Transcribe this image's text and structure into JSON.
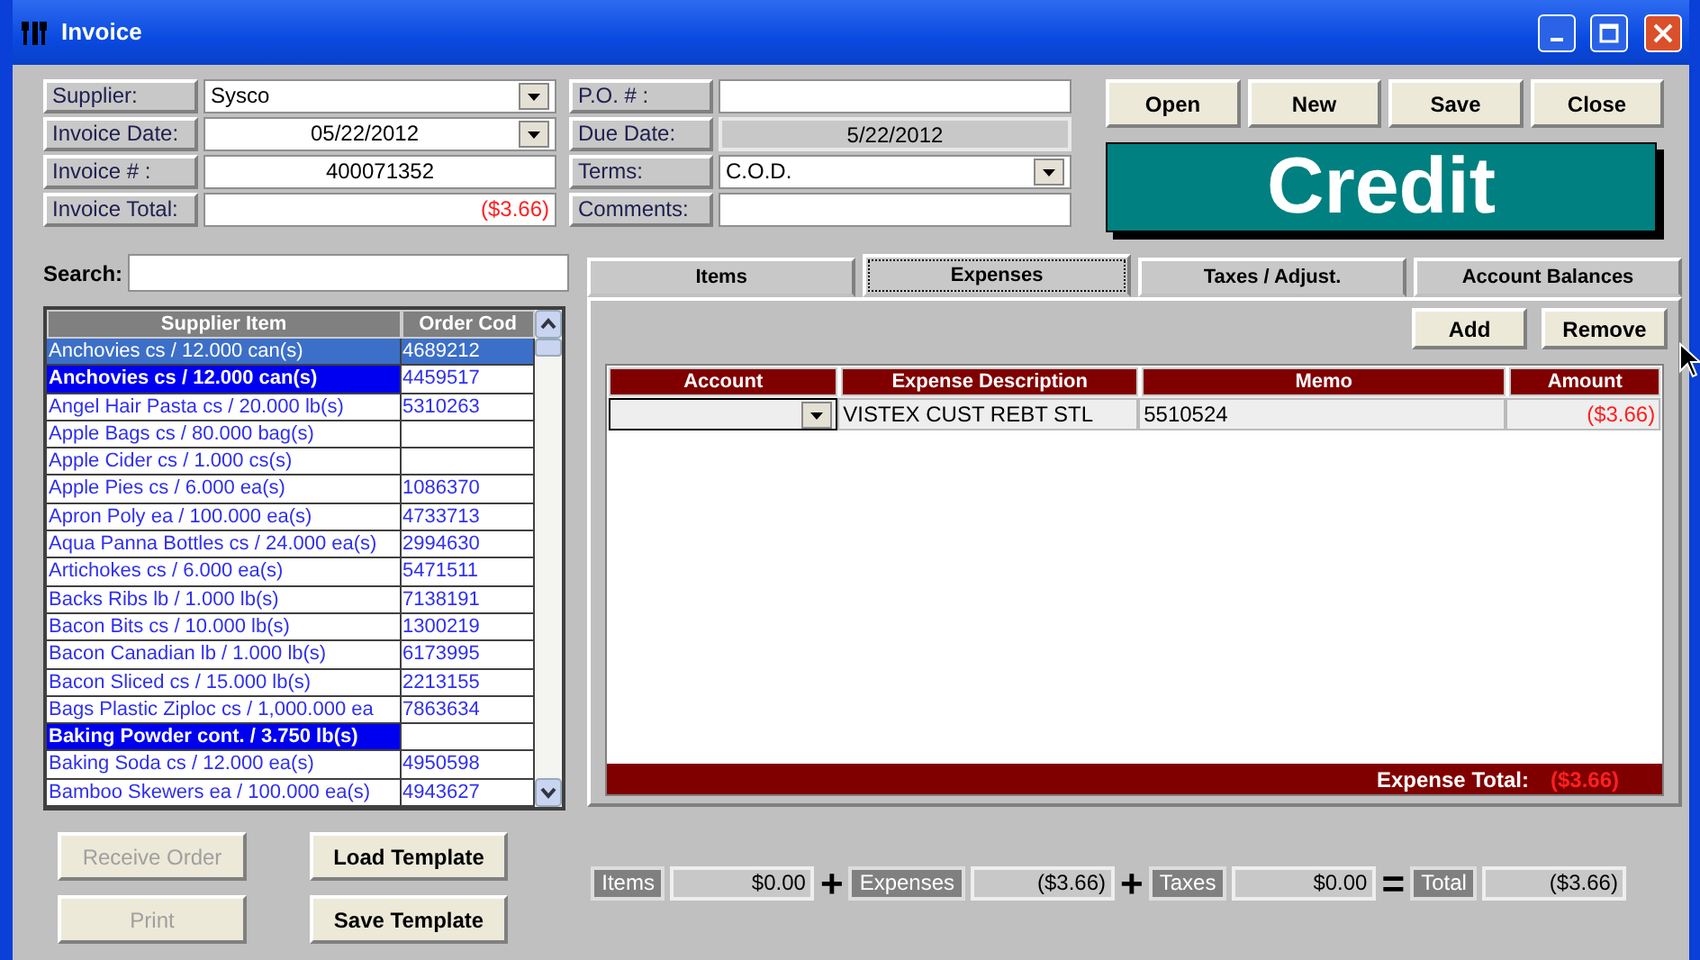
{
  "window": {
    "title": "Invoice"
  },
  "header_left": [
    {
      "label": "Supplier:",
      "value": "Sysco",
      "kind": "dropdown"
    },
    {
      "label": "Invoice Date:",
      "value": "05/22/2012",
      "kind": "date"
    },
    {
      "label": "Invoice # :",
      "value": "400071352",
      "kind": "centered"
    },
    {
      "label": "Invoice Total:",
      "value": "($3.66)",
      "kind": "amount"
    }
  ],
  "header_middle": [
    {
      "label": "P.O. # :",
      "kind": "text"
    },
    {
      "label": "Due Date:",
      "value": "5/22/2012",
      "kind": "readonly"
    },
    {
      "label": "Terms:",
      "value": "C.O.D.",
      "kind": "dropdown"
    },
    {
      "label": "Comments:",
      "kind": "text"
    }
  ],
  "action_buttons": [
    "Open",
    "New",
    "Save",
    "Close"
  ],
  "banner": "Credit",
  "search": {
    "label": "Search:"
  },
  "supplier_items": {
    "columns": [
      "Supplier Item",
      "Order Cod"
    ],
    "rows": [
      {
        "item": "Anchovies cs / 12.000 can(s)",
        "code": "4689212",
        "selected": true,
        "current": true
      },
      {
        "item": "Anchovies cs / 12.000 can(s)",
        "code": "4459517",
        "selected": true,
        "current": false
      },
      {
        "item": "Angel Hair Pasta cs / 20.000 lb(s)",
        "code": "5310263",
        "selected": false,
        "current": false
      },
      {
        "item": "Apple Bags cs / 80.000 bag(s)",
        "selected": false,
        "current": false
      },
      {
        "item": "Apple Cider cs / 1.000 cs(s)",
        "selected": false,
        "current": false
      },
      {
        "item": "Apple Pies  cs / 6.000 ea(s)",
        "code": "1086370",
        "selected": false,
        "current": false
      },
      {
        "item": "Apron Poly ea / 100.000 ea(s)",
        "code": "4733713",
        "selected": false,
        "current": false
      },
      {
        "item": "Aqua Panna Bottles cs / 24.000 ea(s)",
        "code": "2994630",
        "selected": false,
        "current": false
      },
      {
        "item": "Artichokes cs / 6.000 ea(s)",
        "code": "5471511",
        "selected": false,
        "current": false
      },
      {
        "item": "Backs Ribs lb / 1.000 lb(s)",
        "code": "7138191",
        "selected": false,
        "current": false
      },
      {
        "item": "Bacon Bits cs / 10.000 lb(s)",
        "code": "1300219",
        "selected": false,
        "current": false
      },
      {
        "item": "Bacon Canadian  lb / 1.000 lb(s)",
        "code": "6173995",
        "selected": false,
        "current": false
      },
      {
        "item": "Bacon Sliced cs / 15.000 lb(s)",
        "code": "2213155",
        "selected": false,
        "current": false
      },
      {
        "item": "Bags Plastic Ziploc cs / 1,000.000 ea",
        "code": "7863634",
        "selected": false,
        "current": false
      },
      {
        "item": "Baking Powder cont. / 3.750 lb(s)",
        "selected": true,
        "current": false
      },
      {
        "item": "Baking Soda cs / 12.000 ea(s)",
        "code": "4950598",
        "selected": false,
        "current": false
      },
      {
        "item": "Bamboo Skewers ea / 100.000 ea(s)",
        "code": "4943627",
        "selected": false,
        "current": false
      }
    ]
  },
  "left_buttons": [
    {
      "label": "Receive Order",
      "disabled": true
    },
    {
      "label": "Load Template",
      "disabled": false
    },
    {
      "label": "Print",
      "disabled": true
    },
    {
      "label": "Save Template",
      "disabled": false
    }
  ],
  "tabs": [
    {
      "label": "Items",
      "selected": false
    },
    {
      "label": "Expenses",
      "selected": true
    },
    {
      "label": "Taxes / Adjust.",
      "selected": false
    },
    {
      "label": "Account Balances",
      "selected": false
    }
  ],
  "panel_buttons": [
    "Add",
    "Remove"
  ],
  "expenses": {
    "columns": [
      "Account",
      "Expense Description",
      "Memo",
      "Amount"
    ],
    "rows": [
      {
        "description": "VISTEX CUST REBT STL",
        "memo": "5510524",
        "amount": "($3.66)"
      }
    ],
    "total_label": "Expense Total:",
    "total": "($3.66)"
  },
  "totals": [
    {
      "label": "Items",
      "value": "$0.00",
      "operator": "+"
    },
    {
      "label": "Expenses",
      "value": "($3.66)",
      "operator": "+"
    },
    {
      "label": "Taxes",
      "value": "$0.00",
      "operator": "="
    },
    {
      "label": "Total",
      "value": "($3.66)"
    }
  ]
}
